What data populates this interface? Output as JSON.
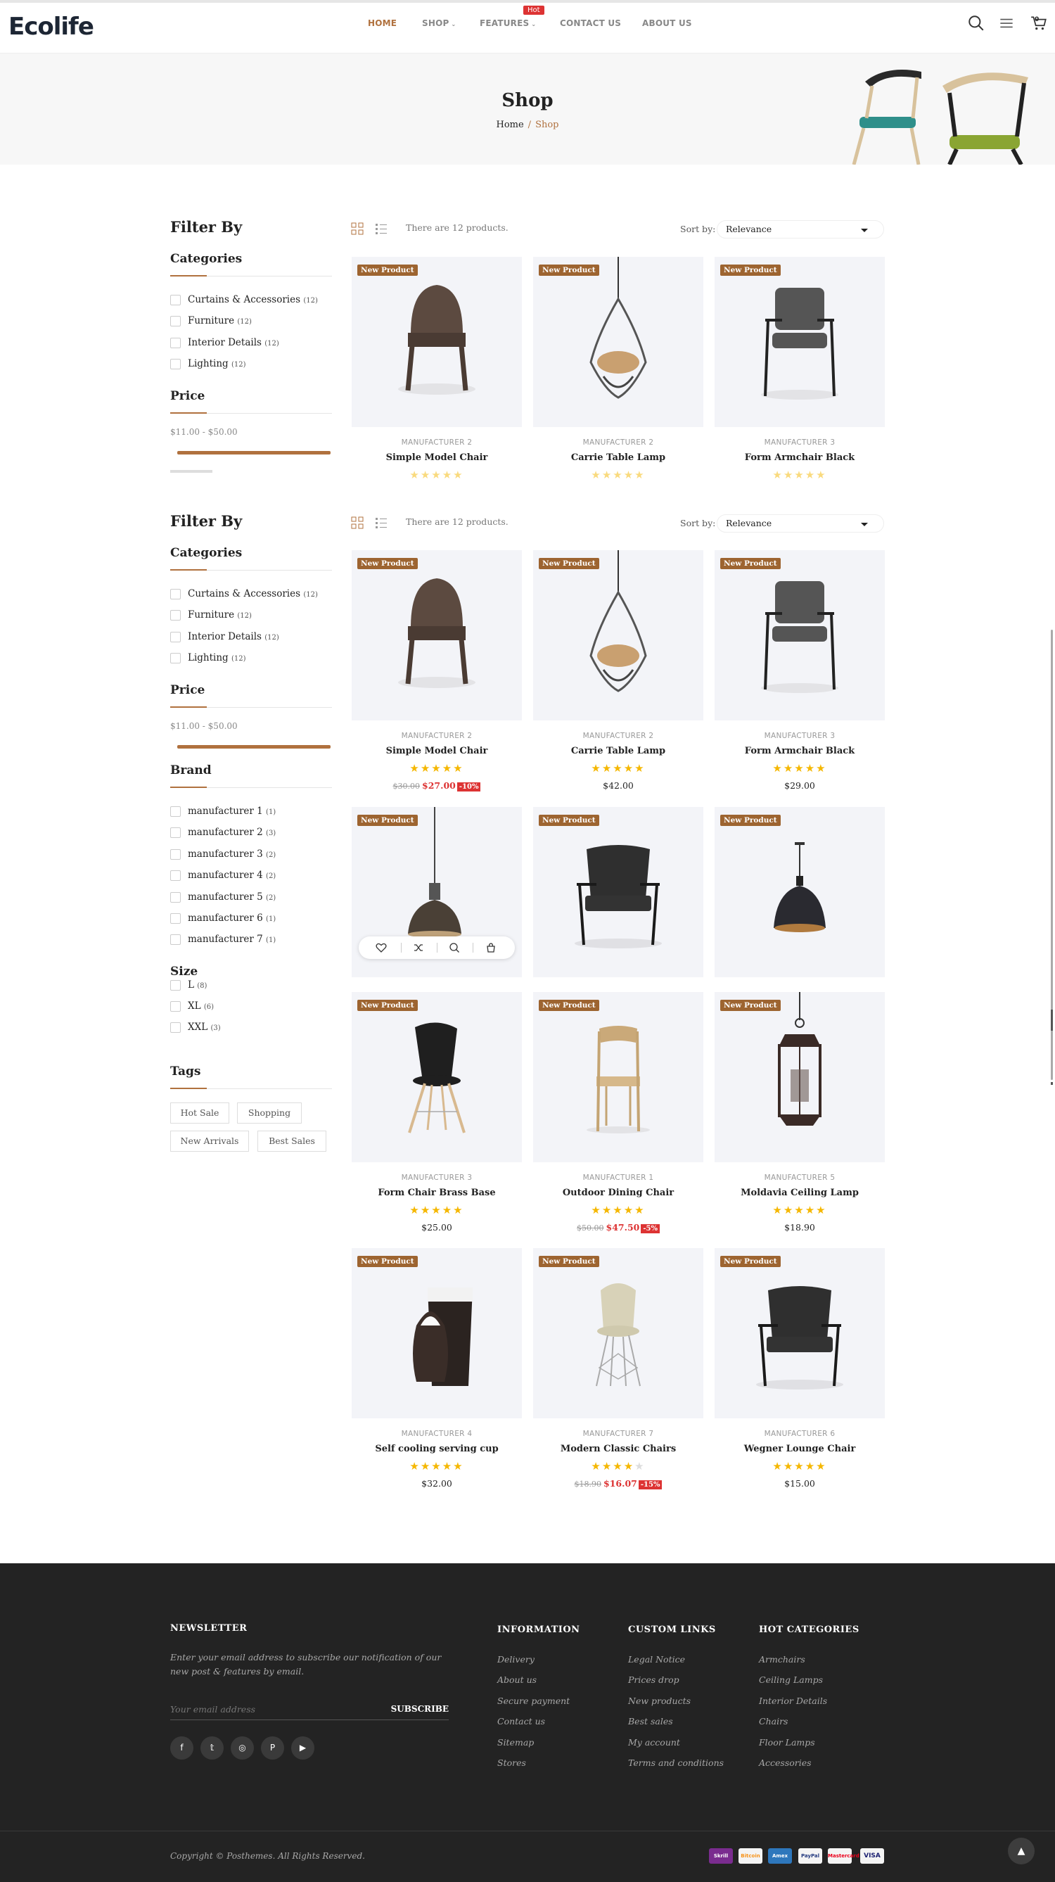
{
  "brand": {
    "logo": "Ecolife",
    "accent": "#b0713e"
  },
  "header": {
    "nav": [
      "HOME",
      "SHOP",
      "FEATURES",
      "CONTACT US",
      "ABOUT US"
    ],
    "hot_badge": "Hot",
    "cart_count": "0",
    "icons": [
      "search-icon",
      "menu-icon",
      "cart-icon"
    ]
  },
  "banner": {
    "title": "Shop",
    "crumb_home": "Home",
    "crumb_sep": "/",
    "crumb_current": "Shop"
  },
  "sidebar": {
    "filter_title": "Filter By",
    "categories_title": "Categories",
    "categories": [
      {
        "label": "Curtains & Accessories",
        "count": "(12)"
      },
      {
        "label": "Furniture",
        "count": "(12)"
      },
      {
        "label": "Interior Details",
        "count": "(12)"
      },
      {
        "label": "Lighting",
        "count": "(12)"
      }
    ],
    "price_title": "Price",
    "price_range": "$11.00 - $50.00",
    "brand_title": "Brand",
    "brands": [
      {
        "label": "manufacturer 1",
        "count": "(1)"
      },
      {
        "label": "manufacturer 2",
        "count": "(3)"
      },
      {
        "label": "manufacturer 3",
        "count": "(2)"
      },
      {
        "label": "manufacturer 4",
        "count": "(2)"
      },
      {
        "label": "manufacturer 5",
        "count": "(2)"
      },
      {
        "label": "manufacturer 6",
        "count": "(1)"
      },
      {
        "label": "manufacturer 7",
        "count": "(1)"
      }
    ],
    "size_title": "Size",
    "sizes": [
      {
        "label": "L",
        "count": "(8)"
      },
      {
        "label": "XL",
        "count": "(6)"
      },
      {
        "label": "XXL",
        "count": "(3)"
      }
    ],
    "tags_title": "Tags",
    "tags": [
      "Hot Sale",
      "Shopping",
      "New Arrivals",
      "Best Sales"
    ]
  },
  "toolbar": {
    "count_text": "There are 12 products.",
    "sort_label": "Sort by:",
    "sort_value": "Relevance"
  },
  "products": [
    {
      "badge": "New Product",
      "mfr": "MANUFACTURER 2",
      "name": "Simple Model Chair",
      "rating": 5,
      "old": "$30.00",
      "price": "$27.00",
      "disc": "-10%"
    },
    {
      "badge": "New Product",
      "mfr": "MANUFACTURER 2",
      "name": "Carrie Table Lamp",
      "rating": 5,
      "price": "$42.00"
    },
    {
      "badge": "New Product",
      "mfr": "MANUFACTURER 3",
      "name": "Form Armchair Black",
      "rating": 5,
      "price": "$29.00"
    },
    {
      "badge": "New Product",
      "mfr": "",
      "name": "",
      "rating": 0,
      "price": ""
    },
    {
      "badge": "New Product",
      "mfr": "",
      "name": "",
      "rating": 0,
      "price": ""
    },
    {
      "badge": "New Product",
      "mfr": "",
      "name": "",
      "rating": 0,
      "price": ""
    },
    {
      "badge": "New Product",
      "mfr": "MANUFACTURER 3",
      "name": "Form Chair Brass Base",
      "rating": 5,
      "price": "$25.00"
    },
    {
      "badge": "New Product",
      "mfr": "MANUFACTURER 1",
      "name": "Outdoor Dining Chair",
      "rating": 5,
      "old": "$50.00",
      "price": "$47.50",
      "disc": "-5%"
    },
    {
      "badge": "New Product",
      "mfr": "MANUFACTURER 5",
      "name": "Moldavia Ceiling Lamp",
      "rating": 5,
      "price": "$18.90"
    },
    {
      "badge": "New Product",
      "mfr": "MANUFACTURER 4",
      "name": "Self cooling serving cup",
      "rating": 5,
      "price": "$32.00"
    },
    {
      "badge": "New Product",
      "mfr": "MANUFACTURER 7",
      "name": "Modern Classic Chairs",
      "rating": 4,
      "old": "$18.90",
      "price": "$16.07",
      "disc": "-15%"
    },
    {
      "badge": "New Product",
      "mfr": "MANUFACTURER 6",
      "name": "Wegner Lounge Chair",
      "rating": 5,
      "price": "$15.00"
    }
  ],
  "footer": {
    "newsletter_title": "NEWSLETTER",
    "newsletter_text": "Enter your email address to subscribe our notification of our new post & features by email.",
    "email_placeholder": "Your email address",
    "subscribe": "SUBSCRIBE",
    "social": [
      "facebook-icon",
      "twitter-icon",
      "instagram-icon",
      "pinterest-icon",
      "youtube-icon"
    ],
    "columns": [
      {
        "title": "INFORMATION",
        "links": [
          "Delivery",
          "About us",
          "Secure payment",
          "Contact us",
          "Sitemap",
          "Stores"
        ]
      },
      {
        "title": "CUSTOM LINKS",
        "links": [
          "Legal Notice",
          "Prices drop",
          "New products",
          "Best sales",
          "My account",
          "Terms and conditions"
        ]
      },
      {
        "title": "HOT CATEGORIES",
        "links": [
          "Armchairs",
          "Ceiling Lamps",
          "Interior Details",
          "Chairs",
          "Floor Lamps",
          "Accessories"
        ]
      }
    ],
    "copyright": "Copyright © Posthemes. All Rights Reserved.",
    "payments": [
      "Skrill",
      "Bitcoin",
      "Amex",
      "PayPal",
      "Mastercard",
      "VISA"
    ]
  }
}
